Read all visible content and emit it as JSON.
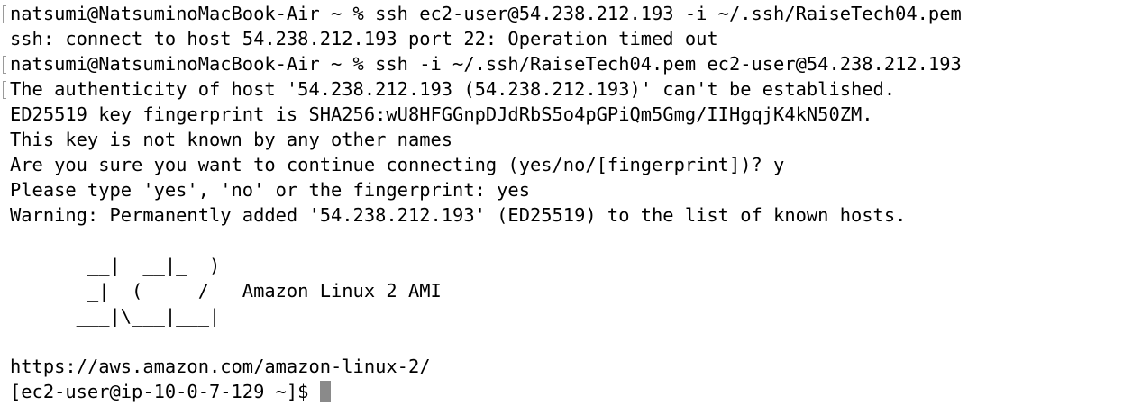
{
  "terminal": {
    "lines": [
      "natsumi@NatsuminoMacBook-Air ~ % ssh ec2-user@54.238.212.193 -i ~/.ssh/RaiseTech04.pem",
      "ssh: connect to host 54.238.212.193 port 22: Operation timed out",
      "natsumi@NatsuminoMacBook-Air ~ % ssh -i ~/.ssh/RaiseTech04.pem ec2-user@54.238.212.193",
      "The authenticity of host '54.238.212.193 (54.238.212.193)' can't be established.",
      "ED25519 key fingerprint is SHA256:wU8HFGGnpDJdRbS5o4pGPiQm5Gmg/IIHgqjK4kN50ZM.",
      "This key is not known by any other names",
      "Are you sure you want to continue connecting (yes/no/[fingerprint])? y",
      "Please type 'yes', 'no' or the fingerprint: yes",
      "Warning: Permanently added '54.238.212.193' (ED25519) to the list of known hosts.",
      "",
      "       __|  __|_  )",
      "       _|  (     /   Amazon Linux 2 AMI",
      "      ___|\\___|___|",
      "",
      "https://aws.amazon.com/amazon-linux-2/"
    ],
    "prompt": "[ec2-user@ip-10-0-7-129 ~]$ ",
    "colors": {
      "background": "#ffffff",
      "text": "#000000",
      "cursor": "#8a8a8a"
    }
  }
}
